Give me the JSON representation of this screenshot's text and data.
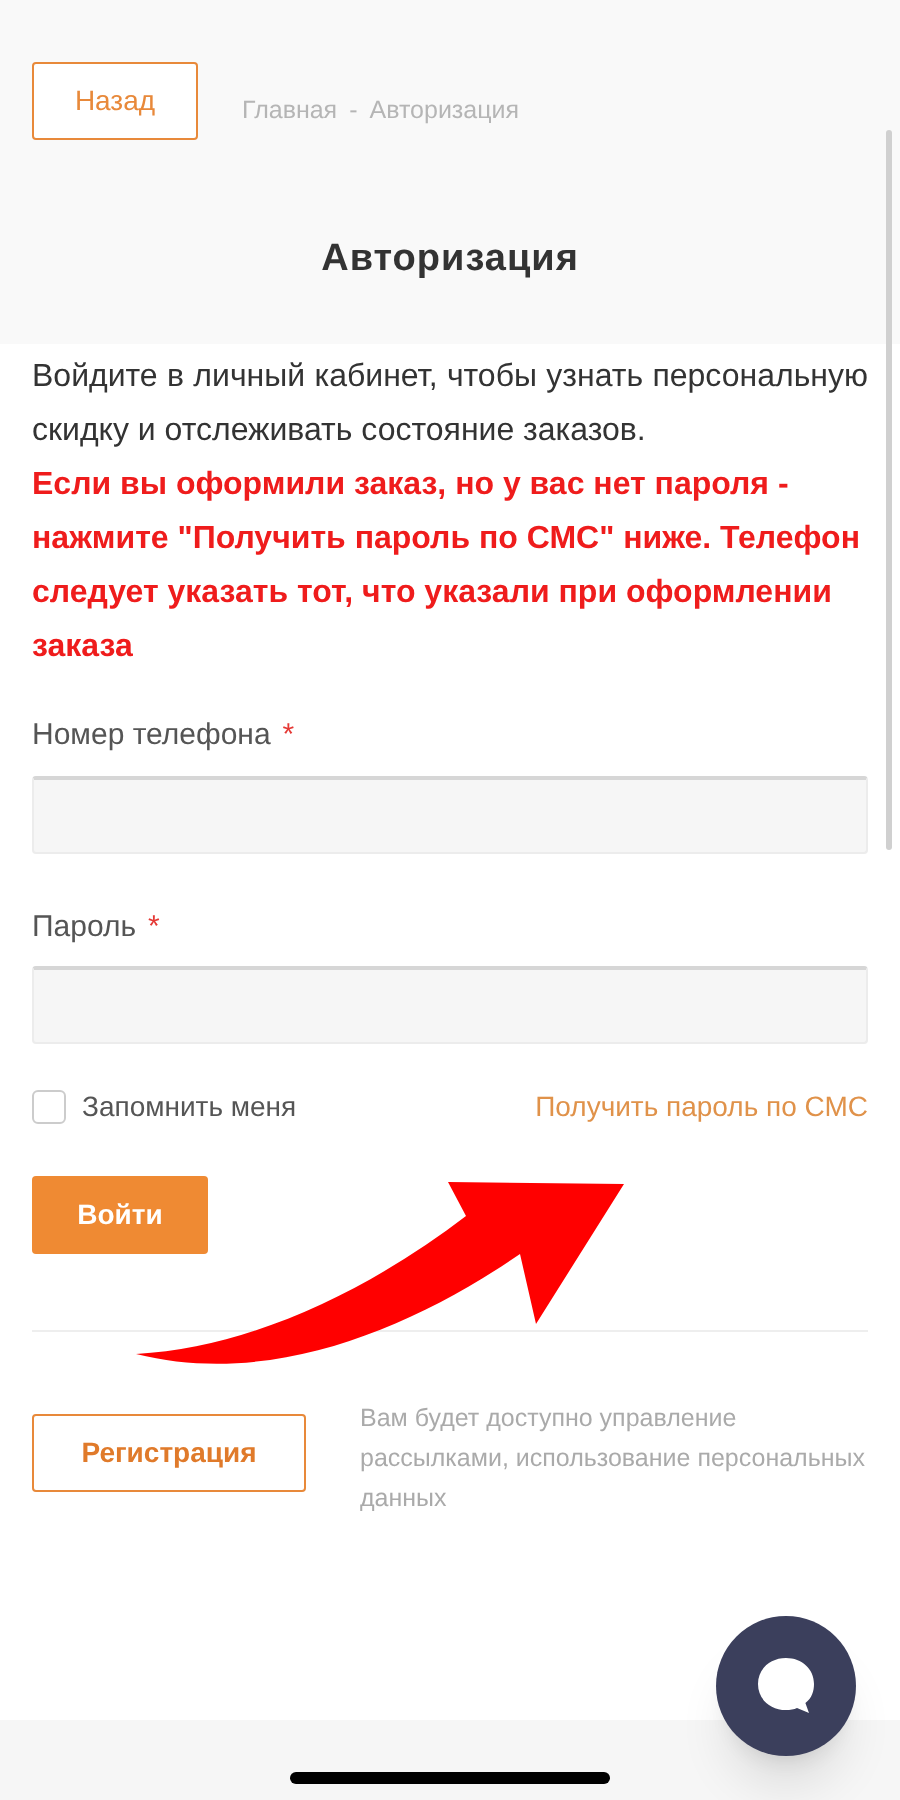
{
  "back_button": "Назад",
  "breadcrumbs": [
    "Главная",
    "Авторизация"
  ],
  "breadcrumb_separator": "-",
  "title": "Авторизация",
  "intro": "Войдите в личный кабинет, чтобы узнать персональную скидку и отслеживать состояние заказов.",
  "notice": "Если вы оформили заказ, но у вас нет пароля - нажмите \"Получить пароль по СМС\" ниже. Телефон следует указать тот, что указали при оформлении заказа",
  "fields": [
    {
      "label": "Номер телефона",
      "required_mark": "*"
    },
    {
      "label": "Пароль",
      "required_mark": "*"
    }
  ],
  "remember": {
    "label": "Запомнить меня",
    "checked": false
  },
  "sms_link": "Получить пароль по СМС",
  "login_button": "Войти",
  "register_button": "Регистрация",
  "register_note": "Вам будет доступно управление рассылками, использование персональных данных"
}
